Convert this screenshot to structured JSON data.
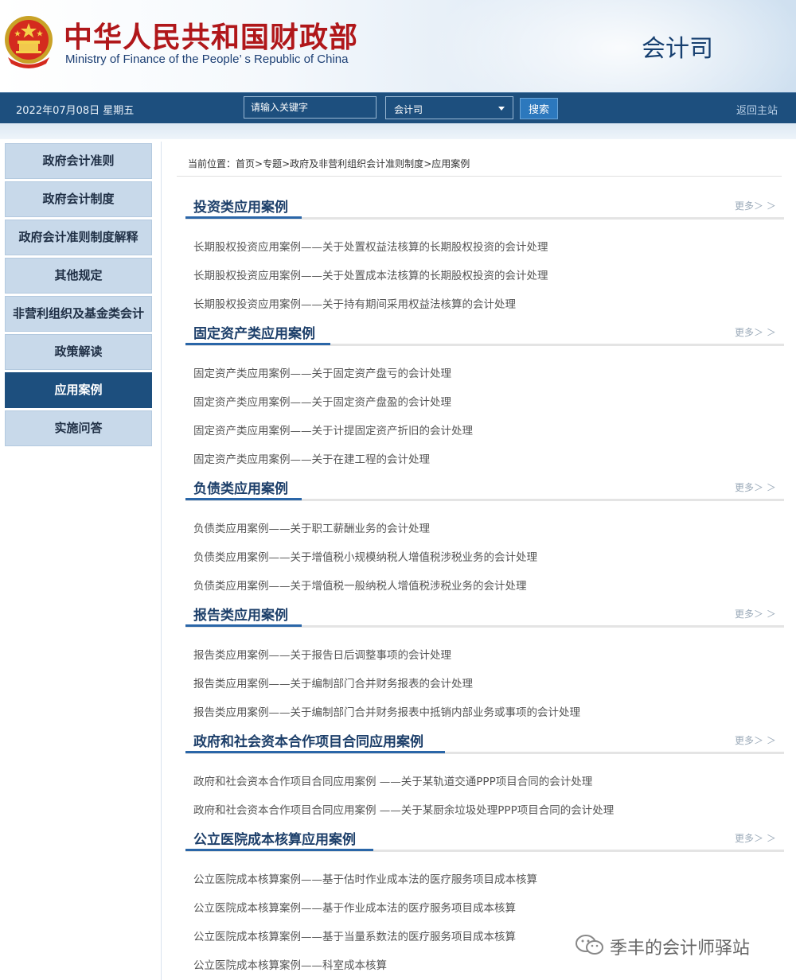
{
  "header": {
    "title_cn": "中华人民共和国财政部",
    "title_en": "Ministry of Finance of the People’ s Republic of China",
    "department": "会计司"
  },
  "topbar": {
    "date": "2022年07月08日  星期五",
    "search_placeholder": "请输入关键字",
    "scope_selected": "会计司",
    "search_button": "搜索",
    "home_link": "返回主站"
  },
  "sidebar": {
    "items": [
      {
        "label": "政府会计准则"
      },
      {
        "label": "政府会计制度"
      },
      {
        "label": "政府会计准则制度解释"
      },
      {
        "label": "其他规定"
      },
      {
        "label": "非营利组织及基金类会计"
      },
      {
        "label": "政策解读"
      },
      {
        "label": "应用案例",
        "active": true
      },
      {
        "label": "实施问答"
      }
    ]
  },
  "breadcrumb": {
    "prefix": "当前位置：",
    "crumbs": [
      "首页",
      "专题",
      "政府及非营利组织会计准则制度",
      "应用案例"
    ]
  },
  "more_label": "更多＞ ＞",
  "sections": [
    {
      "title": "投资类应用案例",
      "items": [
        "长期股权投资应用案例——关于处置权益法核算的长期股权投资的会计处理",
        "长期股权投资应用案例——关于处置成本法核算的长期股权投资的会计处理",
        "长期股权投资应用案例——关于持有期间采用权益法核算的会计处理"
      ]
    },
    {
      "title": "固定资产类应用案例",
      "items": [
        "固定资产类应用案例——关于固定资产盘亏的会计处理",
        "固定资产类应用案例——关于固定资产盘盈的会计处理",
        "固定资产类应用案例——关于计提固定资产折旧的会计处理",
        "固定资产类应用案例——关于在建工程的会计处理"
      ]
    },
    {
      "title": "负债类应用案例",
      "items": [
        "负债类应用案例——关于职工薪酬业务的会计处理",
        "负债类应用案例——关于增值税小规模纳税人增值税涉税业务的会计处理",
        "负债类应用案例——关于增值税一般纳税人增值税涉税业务的会计处理"
      ]
    },
    {
      "title": "报告类应用案例",
      "items": [
        "报告类应用案例——关于报告日后调整事项的会计处理",
        "报告类应用案例——关于编制部门合并财务报表的会计处理",
        "报告类应用案例——关于编制部门合并财务报表中抵销内部业务或事项的会计处理"
      ]
    },
    {
      "title": "政府和社会资本合作项目合同应用案例",
      "items": [
        "政府和社会资本合作项目合同应用案例 ——关于某轨道交通PPP项目合同的会计处理",
        "政府和社会资本合作项目合同应用案例 ——关于某厨余垃圾处理PPP项目合同的会计处理"
      ]
    },
    {
      "title": "公立医院成本核算应用案例",
      "items": [
        "公立医院成本核算案例——基于估时作业成本法的医疗服务项目成本核算",
        "公立医院成本核算案例——基于作业成本法的医疗服务项目成本核算",
        "公立医院成本核算案例——基于当量系数法的医疗服务项目成本核算",
        "公立医院成本核算案例——科室成本核算"
      ]
    }
  ],
  "watermark": {
    "text": "季丰的会计师驿站"
  },
  "colors": {
    "brand_red": "#b0171a",
    "nav_blue": "#1d4f7e",
    "title_blue": "#1d3f6a",
    "accent_blue": "#2a66a8",
    "sidebar_bg": "#c8d9ea"
  }
}
